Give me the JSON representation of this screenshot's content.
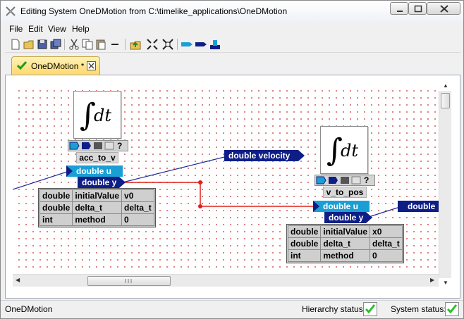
{
  "window": {
    "title": "Editing System OneDMotion from C:\\timelike_applications\\OneDMotion"
  },
  "menu": [
    "File",
    "Edit",
    "View",
    "Help"
  ],
  "toolbar_icons": [
    "new-file-icon",
    "open-folder-icon",
    "save-icon",
    "save-all-icon",
    "cut-icon",
    "copy-icon",
    "paste-icon",
    "delete-icon",
    "import-icon",
    "collapse-icon",
    "expand-icon",
    "input-port-icon",
    "output-port-icon",
    "parameter-icon"
  ],
  "tab": {
    "label": "OneDMotion *"
  },
  "canvas": {
    "block1": {
      "symbol": "∫dt",
      "name": "acc_to_v",
      "input": "double u",
      "output": "double y",
      "params": [
        [
          "double",
          "initialValue",
          "v0"
        ],
        [
          "double",
          "delta_t",
          "delta_t"
        ],
        [
          "int",
          "method",
          "0"
        ]
      ]
    },
    "block2": {
      "symbol": "∫dt",
      "name": "v_to_pos",
      "input": "double u",
      "output": "double y",
      "params": [
        [
          "double",
          "initialValue",
          "x0"
        ],
        [
          "double",
          "delta_t",
          "delta_t"
        ],
        [
          "int",
          "method",
          "0"
        ]
      ]
    },
    "velocity_port": "double velocity",
    "right_port": "double",
    "help_glyph": "?"
  },
  "status": {
    "left": "OneDMotion",
    "hierarchy_label": "Hierarchy status:",
    "system_label": "System status:"
  },
  "colors": {
    "port_out": "#0e1e86",
    "port_in": "#1a9fd4",
    "wire_red": "#e0201c",
    "wire_blue": "#1e2a9c",
    "status_ok": "#2bbf2b"
  }
}
